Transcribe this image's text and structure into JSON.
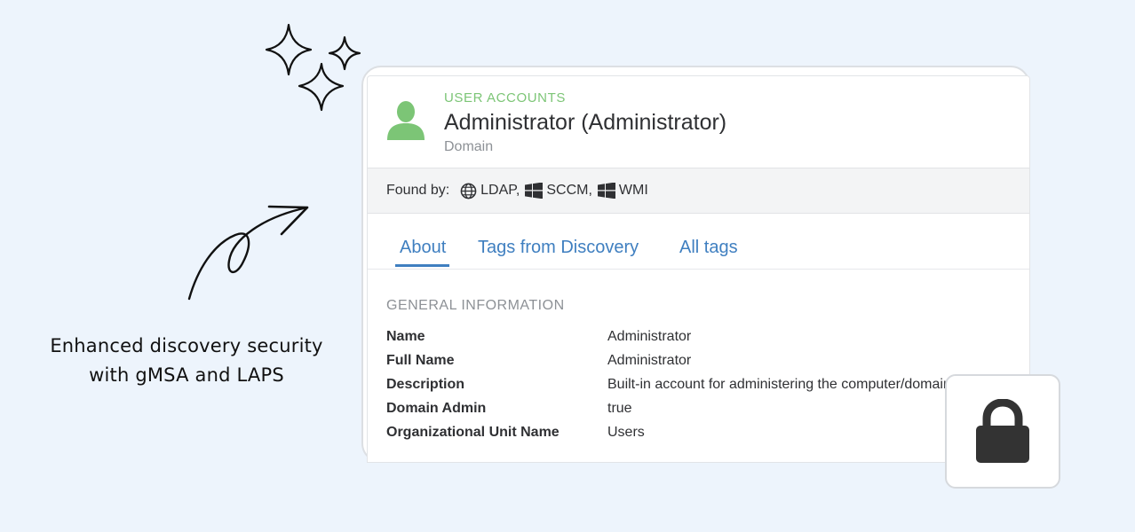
{
  "caption": {
    "line1": "Enhanced discovery security",
    "line2": "with gMSA and LAPS"
  },
  "card": {
    "category": "USER ACCOUNTS",
    "title": "Administrator (Administrator)",
    "subtitle": "Domain",
    "found_by_label": "Found by:",
    "sources": [
      {
        "label": "LDAP,",
        "icon": "globe-icon"
      },
      {
        "label": "SCCM,",
        "icon": "windows-icon"
      },
      {
        "label": "WMI",
        "icon": "windows-icon"
      }
    ],
    "tabs": [
      {
        "label": "About",
        "active": true
      },
      {
        "label": "Tags from Discovery",
        "active": false
      },
      {
        "label": "All tags",
        "active": false
      }
    ],
    "section_title": "GENERAL INFORMATION",
    "fields": [
      {
        "key": "Name",
        "value": "Administrator"
      },
      {
        "key": "Full Name",
        "value": "Administrator"
      },
      {
        "key": "Description",
        "value": "Built-in account for administering the computer/domain"
      },
      {
        "key": "Domain Admin",
        "value": "true"
      },
      {
        "key": "Organizational Unit Name",
        "value": "Users"
      }
    ]
  },
  "icons": {
    "avatar": "user-icon",
    "lock": "lock-icon",
    "decoration": "sparkles-icon",
    "pointer": "curly-arrow-icon"
  },
  "colors": {
    "background": "#edf4fc",
    "accent_green": "#7cc576",
    "link_blue": "#3f7fc0",
    "text_dark": "#2f3033"
  }
}
